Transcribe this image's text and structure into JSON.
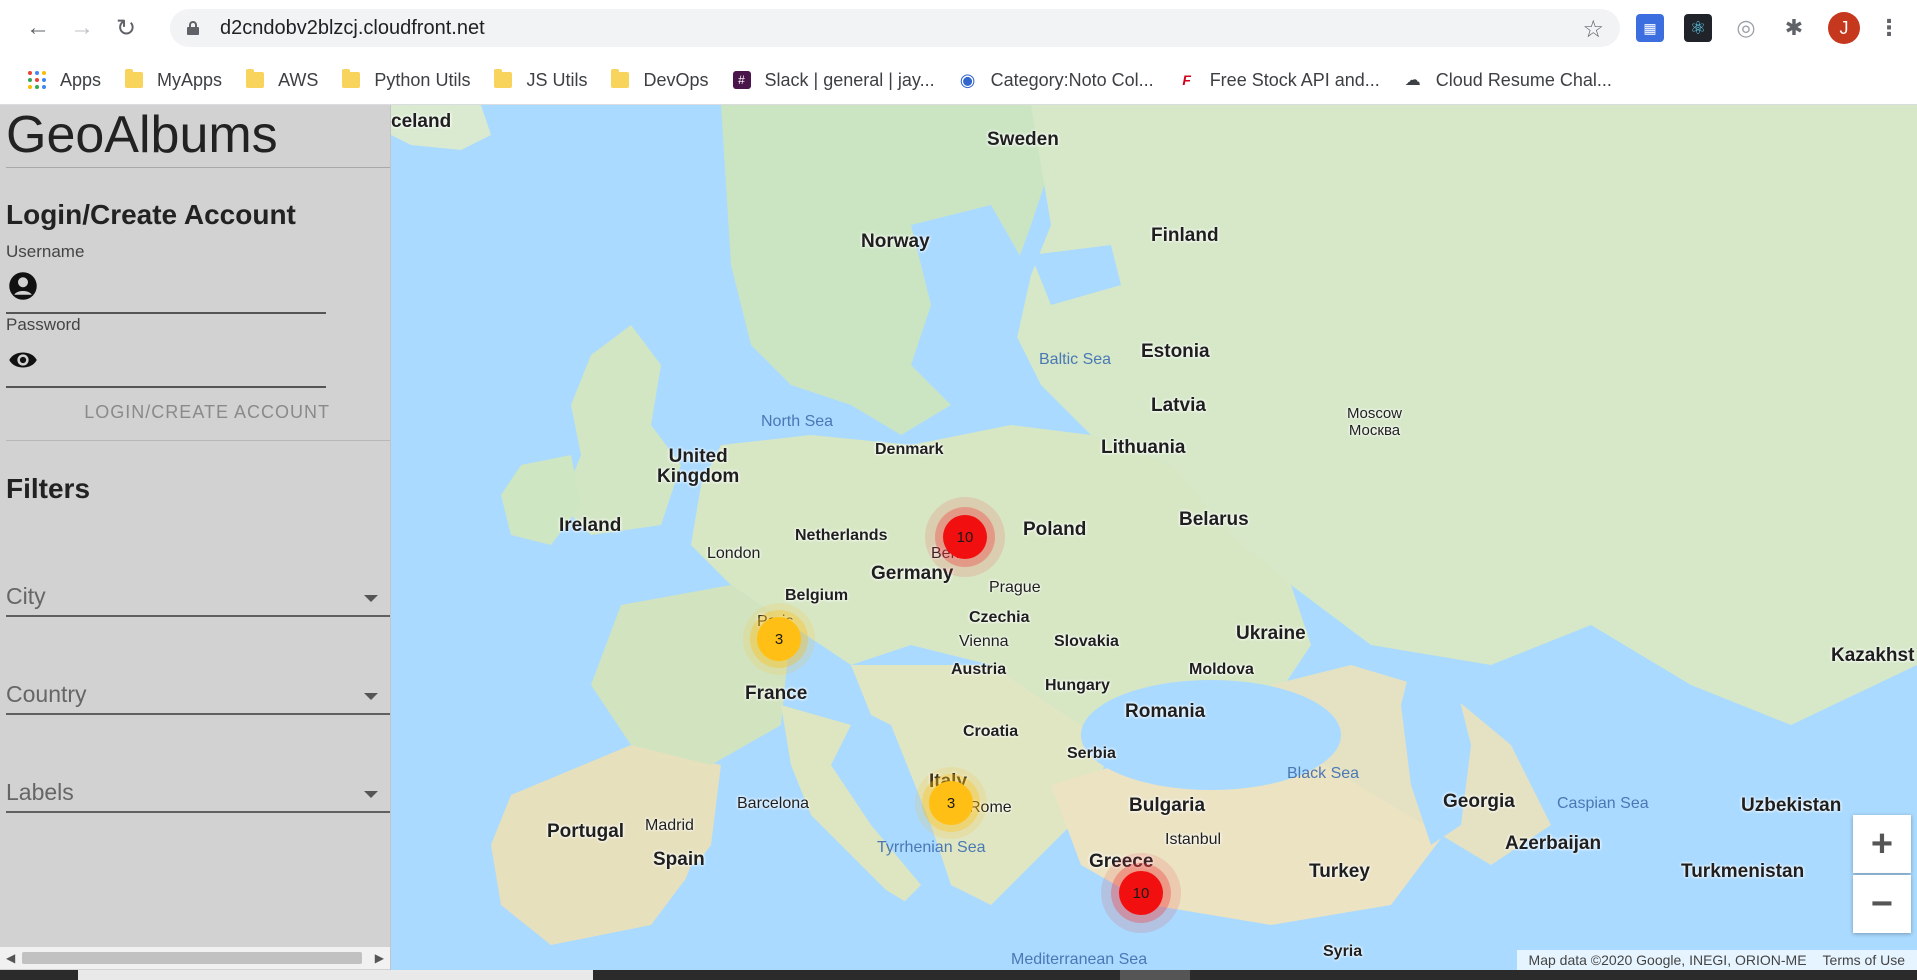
{
  "browser": {
    "url": "d2cndobv2blzcj.cloudfront.net",
    "profile_initial": "J",
    "bookmarks": [
      {
        "label": "Apps",
        "icon": "apps-grid-icon"
      },
      {
        "label": "MyApps",
        "icon": "folder-icon"
      },
      {
        "label": "AWS",
        "icon": "folder-icon"
      },
      {
        "label": "Python Utils",
        "icon": "folder-icon"
      },
      {
        "label": "JS Utils",
        "icon": "folder-icon"
      },
      {
        "label": "DevOps",
        "icon": "folder-icon"
      },
      {
        "label": "Slack | general | jay...",
        "icon": "slack-icon"
      },
      {
        "label": "Category:Noto Col...",
        "icon": "wikimedia-icon"
      },
      {
        "label": "Free Stock API and...",
        "icon": "finnhub-icon"
      },
      {
        "label": "Cloud Resume Chal...",
        "icon": "cloud-icon"
      }
    ]
  },
  "sidebar": {
    "title": "GeoAlbums",
    "login": {
      "heading": "Login/Create Account",
      "username_label": "Username",
      "username_value": "",
      "password_label": "Password",
      "password_value": "",
      "button_label": "LOGIN/CREATE ACCOUNT"
    },
    "filters": {
      "heading": "Filters",
      "city": "City",
      "country": "Country",
      "labels": "Labels"
    }
  },
  "map": {
    "labels": {
      "iceland": "celand",
      "sweden": "Sweden",
      "norway": "Norway",
      "finland": "Finland",
      "estonia": "Estonia",
      "latvia": "Latvia",
      "lithuania": "Lithuania",
      "denmark": "Denmark",
      "uk": "United\nKingdom",
      "ireland": "Ireland",
      "netherlands": "Netherlands",
      "belgium": "Belgium",
      "germany": "Germany",
      "poland": "Poland",
      "belarus": "Belarus",
      "czechia": "Czechia",
      "slovakia": "Slovakia",
      "austria": "Austria",
      "hungary": "Hungary",
      "ukraine": "Ukraine",
      "moldova": "Moldova",
      "romania": "Romania",
      "france": "France",
      "croatia": "Croatia",
      "serbia": "Serbia",
      "italy": "Italy",
      "bulgaria": "Bulgaria",
      "greece": "Greece",
      "turkey": "Turkey",
      "portugal": "Portugal",
      "spain": "Spain",
      "georgia": "Georgia",
      "azerbaijan": "Azerbaijan",
      "uzbekistan": "Uzbekistan",
      "turkmenistan": "Turkmenistan",
      "kazakh": "Kazakhst",
      "syria": "Syria",
      "london": "London",
      "berlin": "Berlin",
      "paris": "Paris",
      "prague": "Prague",
      "vienna": "Vienna",
      "rome": "Rome",
      "madrid": "Madrid",
      "barcelona": "Barcelona",
      "istanbul": "Istanbul",
      "moscow": "Moscow\nМосква",
      "north_sea": "North Sea",
      "baltic_sea": "Baltic Sea",
      "black_sea": "Black Sea",
      "caspian_sea": "Caspian Sea",
      "tyrrhenian_sea": "Tyrrhenian Sea",
      "med_sea": "Mediterranean Sea"
    },
    "clusters": [
      {
        "id": "berlin",
        "count": "10",
        "color": "#f10f0f"
      },
      {
        "id": "paris",
        "count": "3",
        "color": "#ffbf14"
      },
      {
        "id": "rome",
        "count": "3",
        "color": "#ffbf14"
      },
      {
        "id": "greece",
        "count": "10",
        "color": "#f10f0f"
      }
    ],
    "zoom_in": "+",
    "zoom_out": "−",
    "attribution": "Map data ©2020 Google, INEGI, ORION-ME",
    "terms": "Terms of Use"
  }
}
